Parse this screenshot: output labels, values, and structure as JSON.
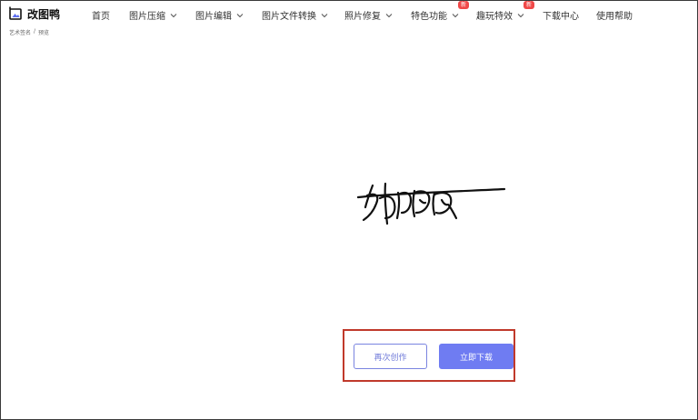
{
  "header": {
    "logo_text": "改图鸭",
    "nav": [
      {
        "label": "首页",
        "dropdown": false
      },
      {
        "label": "图片压缩",
        "dropdown": true
      },
      {
        "label": "图片编辑",
        "dropdown": true
      },
      {
        "label": "图片文件转换",
        "dropdown": true
      },
      {
        "label": "照片修复",
        "dropdown": true
      },
      {
        "label": "特色功能",
        "dropdown": true,
        "badge": "新"
      },
      {
        "label": "趣玩特效",
        "dropdown": true,
        "badge": "新"
      },
      {
        "label": "下载中心",
        "dropdown": false
      },
      {
        "label": "使用帮助",
        "dropdown": false
      }
    ]
  },
  "breadcrumb": {
    "items": [
      "艺术签名",
      "预览"
    ],
    "separator": "/"
  },
  "actions": {
    "recreate_label": "再次创作",
    "download_label": "立即下载"
  },
  "colors": {
    "accent": "#6f7cf2",
    "badge": "#f04848",
    "highlight": "#c0392b"
  }
}
